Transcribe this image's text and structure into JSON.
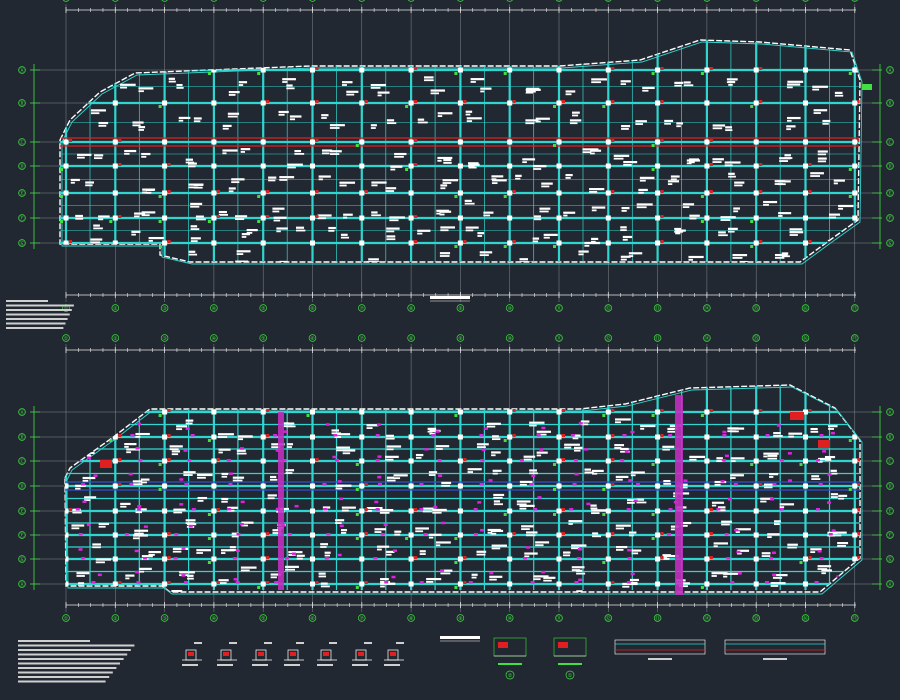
{
  "drawing": {
    "background": "#222831",
    "colors": {
      "grid": "#9aa0a6",
      "beam": "#2fd6d0",
      "outline": "#ffffff",
      "axis": "#3fe03f",
      "column": "#ffffff",
      "rebar_red": "#e02020",
      "rebar_magenta": "#e020e0",
      "band_magenta": "#c030c0",
      "dim": "#e8e8e8"
    },
    "axis_labels": [
      "①",
      "②",
      "③",
      "④",
      "⑤",
      "⑥",
      "⑦",
      "⑧",
      "⑨",
      "⑩",
      "⑪",
      "⑫",
      "⑬",
      "⑭",
      "⑮",
      "⑯",
      "⑰"
    ],
    "row_labels": [
      "Ⓐ",
      "Ⓑ",
      "Ⓒ",
      "Ⓓ",
      "Ⓔ",
      "Ⓕ",
      "Ⓖ"
    ],
    "plan_top": {
      "title": ""
    },
    "plan_bottom": {
      "title": ""
    },
    "section_marks": [
      "②",
      "①"
    ]
  }
}
